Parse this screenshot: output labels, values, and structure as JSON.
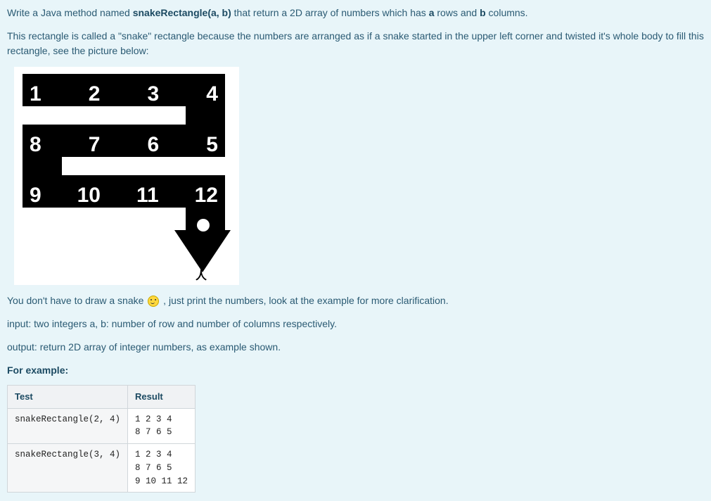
{
  "intro": {
    "line1_pre": "Write a Java method named ",
    "method_name": "snakeRectangle(a, b)",
    "line1_mid": " that return a 2D array of numbers which has ",
    "bold_a": "a",
    "line1_rows": " rows and ",
    "bold_b": "b",
    "line1_end": " columns.",
    "line2": "This rectangle is called a \"snake\" rectangle because the numbers are arranged as if a snake started in the upper left corner and twisted it's whole body to fill this rectangle, see the picture below:"
  },
  "snake": {
    "row1": [
      "1",
      "2",
      "3",
      "4"
    ],
    "row2": [
      "8",
      "7",
      "6",
      "5"
    ],
    "row3": [
      "9",
      "10",
      "11",
      "12"
    ]
  },
  "after_image": {
    "pre": "You don't have to draw a snake ",
    "post": " , just print the numbers, look at the example for more clarification."
  },
  "input_line": "input: two integers a, b: number of row and number of columns respectively.",
  "output_line": "output: return 2D array of integer numbers, as example shown.",
  "example_label": "For example:",
  "table": {
    "headers": {
      "test": "Test",
      "result": "Result"
    },
    "rows": [
      {
        "test": "snakeRectangle(2, 4)",
        "result": "1 2 3 4\n8 7 6 5"
      },
      {
        "test": "snakeRectangle(3, 4)",
        "result": "1 2 3 4\n8 7 6 5\n9 10 11 12"
      }
    ]
  }
}
